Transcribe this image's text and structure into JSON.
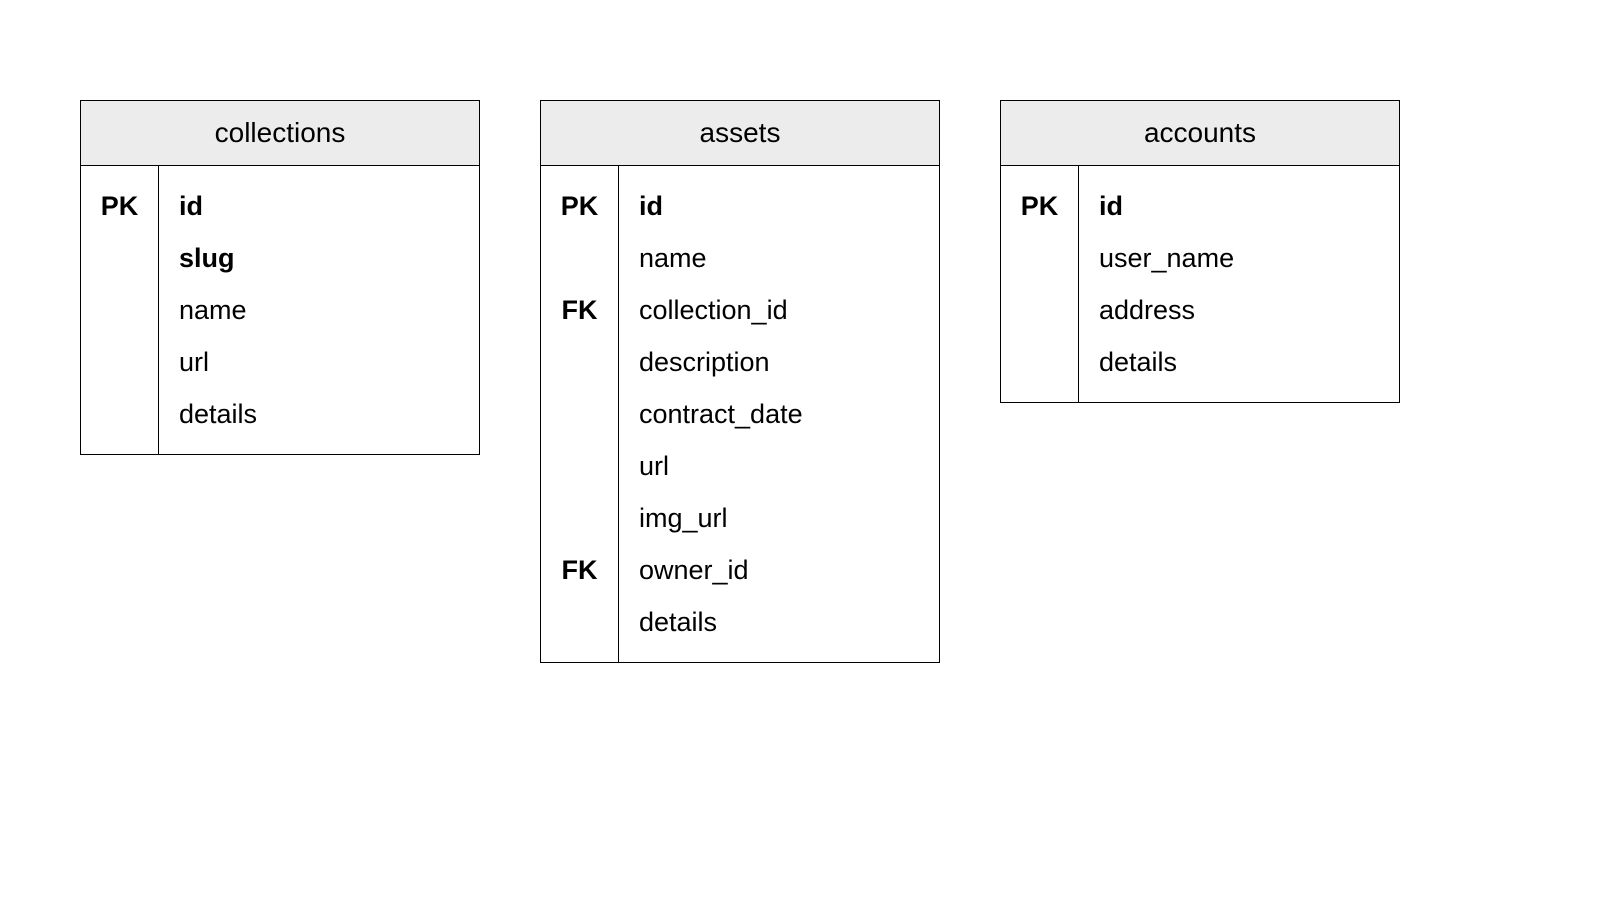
{
  "tables": {
    "collections": {
      "title": "collections",
      "rows": [
        {
          "key": "PK",
          "field": "id",
          "bold": true
        },
        {
          "key": "",
          "field": "slug",
          "bold": true
        },
        {
          "key": "",
          "field": "name",
          "bold": false
        },
        {
          "key": "",
          "field": "url",
          "bold": false
        },
        {
          "key": "",
          "field": "details",
          "bold": false
        }
      ]
    },
    "assets": {
      "title": "assets",
      "rows": [
        {
          "key": "PK",
          "field": "id",
          "bold": true
        },
        {
          "key": "",
          "field": "name",
          "bold": false
        },
        {
          "key": "FK",
          "field": "collection_id",
          "bold": false
        },
        {
          "key": "",
          "field": "description",
          "bold": false
        },
        {
          "key": "",
          "field": "contract_date",
          "bold": false
        },
        {
          "key": "",
          "field": "url",
          "bold": false
        },
        {
          "key": "",
          "field": "img_url",
          "bold": false
        },
        {
          "key": "FK",
          "field": "owner_id",
          "bold": false
        },
        {
          "key": "",
          "field": "details",
          "bold": false
        }
      ]
    },
    "accounts": {
      "title": "accounts",
      "rows": [
        {
          "key": "PK",
          "field": "id",
          "bold": true
        },
        {
          "key": "",
          "field": "user_name",
          "bold": false
        },
        {
          "key": "",
          "field": "address",
          "bold": false
        },
        {
          "key": "",
          "field": "details",
          "bold": false
        }
      ]
    }
  }
}
